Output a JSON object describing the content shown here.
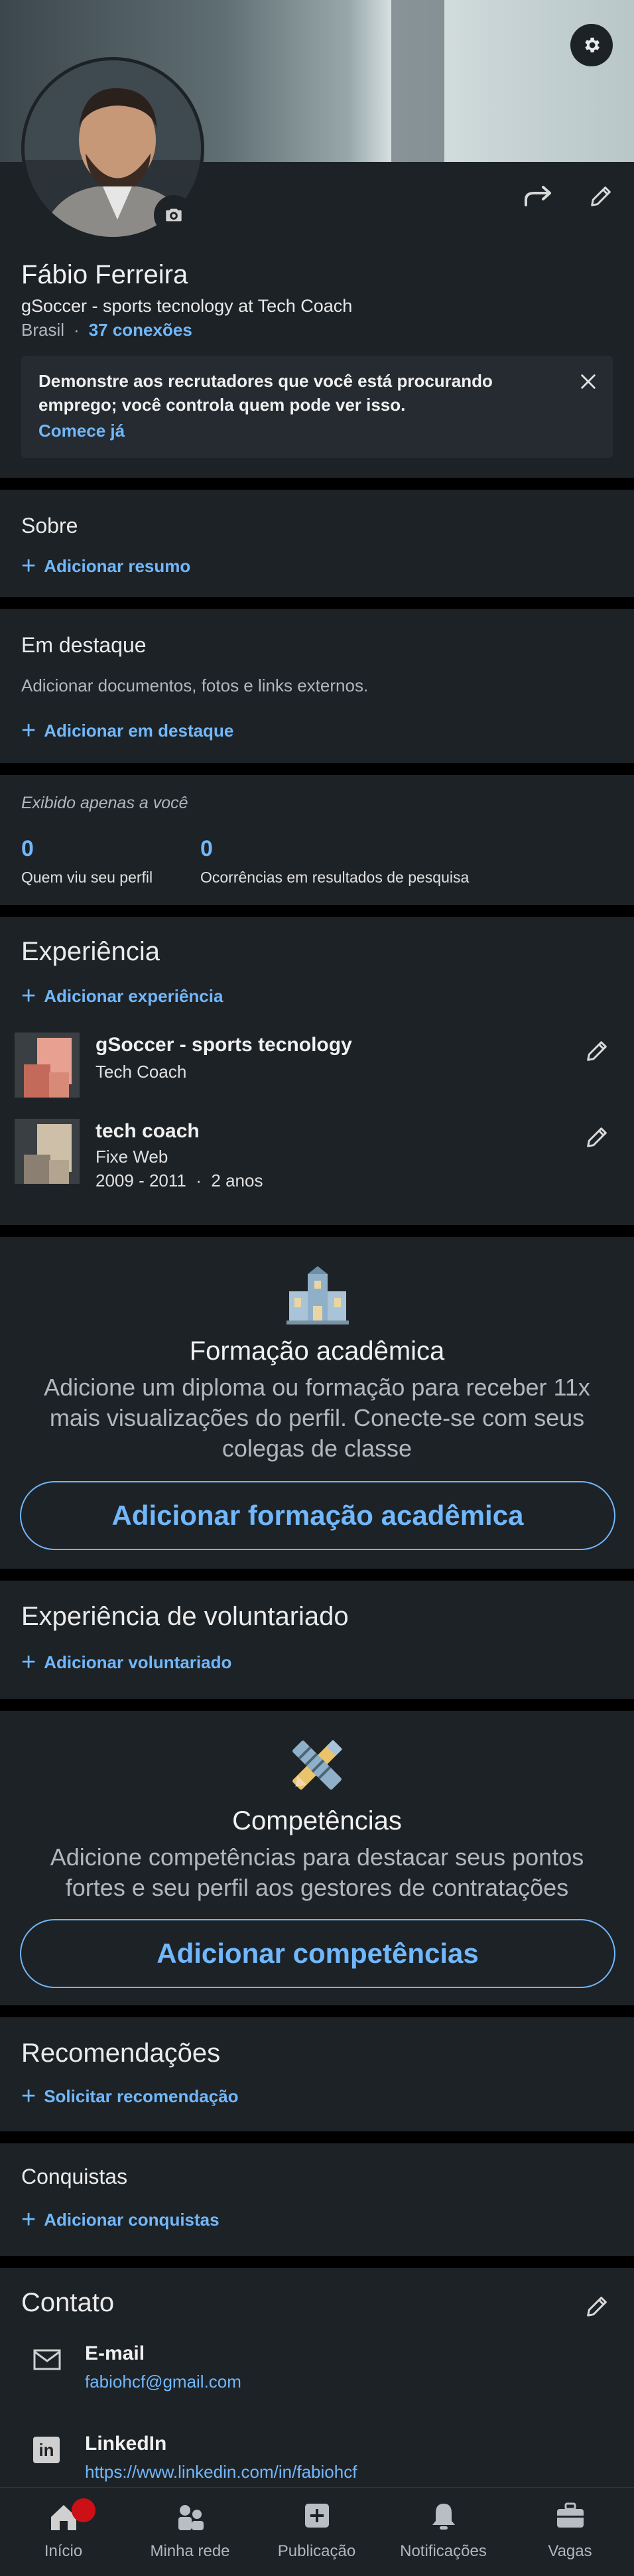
{
  "header": {
    "settings_icon": "gear-icon",
    "camera_icon": "camera-icon",
    "share_icon": "share-icon",
    "edit_icon": "pencil-icon"
  },
  "profile": {
    "name": "Fábio Ferreira",
    "headline": "gSoccer - sports tecnology at Tech Coach",
    "location": "Brasil",
    "connections": "37 conexões",
    "banner_text": "Demonstre aos recrutadores que você está procurando emprego; você controla quem pode ver isso.",
    "banner_link": "Comece já"
  },
  "about": {
    "title": "Sobre",
    "add_label": "Adicionar resumo"
  },
  "featured": {
    "title": "Em destaque",
    "description": "Adicionar documentos, fotos e links externos.",
    "add_label": "Adicionar em destaque"
  },
  "analytics": {
    "note": "Exibido apenas a você",
    "items": [
      {
        "value": "0",
        "label": "Quem viu seu perfil"
      },
      {
        "value": "0",
        "label": "Ocorrências em resultados de pesquisa"
      }
    ]
  },
  "experience": {
    "title": "Experiência",
    "add_label": "Adicionar experiência",
    "items": [
      {
        "role": "gSoccer - sports tecnology",
        "company": "Tech Coach",
        "dates": ""
      },
      {
        "role": "tech coach",
        "company": "Fixe Web",
        "dates": "2009 - 2011  ·  2 anos"
      }
    ]
  },
  "education": {
    "title": "Formação acadêmica",
    "description": "Adicione um diploma ou formação para receber 11x mais visualizações do perfil. Conecte-se com seus colegas de classe",
    "button": "Adicionar formação acadêmica"
  },
  "volunteer": {
    "title": "Experiência de voluntariado",
    "add_label": "Adicionar voluntariado"
  },
  "skills": {
    "title": "Competências",
    "description": "Adicione competências para destacar seus pontos fortes e seu perfil aos gestores de contratações",
    "button": "Adicionar competências"
  },
  "recommendations": {
    "title": "Recomendações",
    "add_label": "Solicitar recomendação"
  },
  "accomplishments": {
    "title": "Conquistas",
    "add_label": "Adicionar conquistas"
  },
  "contact": {
    "title": "Contato",
    "email_label": "E-mail",
    "email_value": "fabiohcf@gmail.com",
    "linkedin_label": "LinkedIn",
    "linkedin_value": "https://www.linkedin.com/in/fabiohcf"
  },
  "bottom_nav": [
    {
      "label": "Início",
      "icon": "home-icon"
    },
    {
      "label": "Minha rede",
      "icon": "network-icon"
    },
    {
      "label": "Publicação",
      "icon": "post-icon"
    },
    {
      "label": "Notificações",
      "icon": "bell-icon"
    },
    {
      "label": "Vagas",
      "icon": "briefcase-icon"
    }
  ],
  "colors": {
    "accent": "#71b7fb",
    "card": "#1d2226",
    "badge": "#cc1016"
  }
}
